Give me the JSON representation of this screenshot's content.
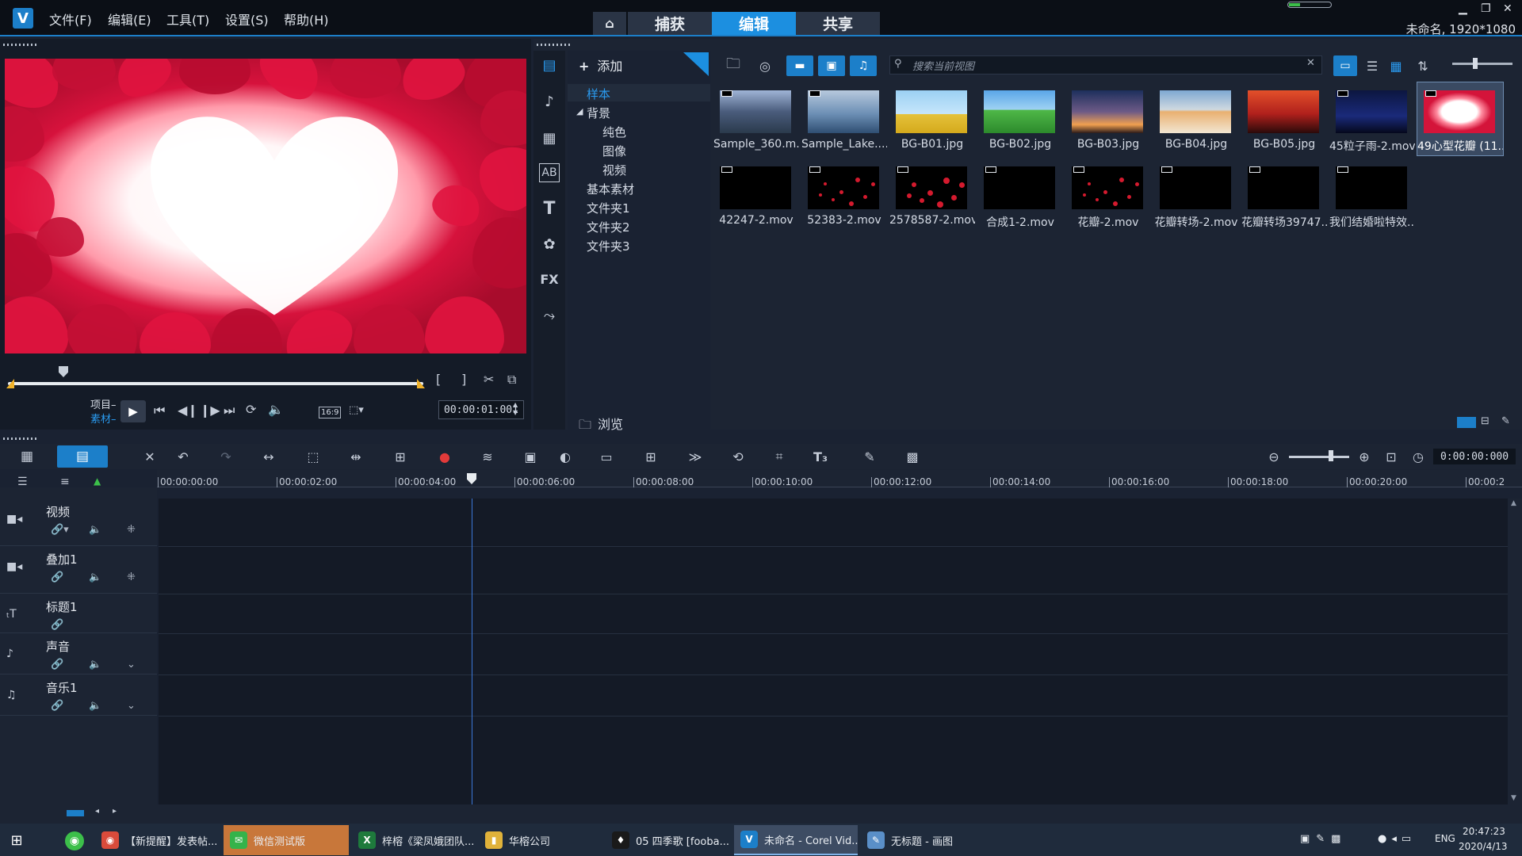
{
  "menu": [
    "文件(F)",
    "编辑(E)",
    "工具(T)",
    "设置(S)",
    "帮助(H)"
  ],
  "workspace_tabs": [
    "捕获",
    "编辑",
    "共享"
  ],
  "active_tab": "编辑",
  "project_title": "未命名, 1920*1080",
  "player": {
    "mode_project": "项目",
    "mode_clip": "素材",
    "aspect": "16:9",
    "timecode": "00:00:01:001"
  },
  "library": {
    "add_label": "添加",
    "browse_label": "浏览",
    "search_placeholder": "搜索当前视图",
    "tree": [
      {
        "label": "样本",
        "level": 0,
        "selected": true
      },
      {
        "label": "背景",
        "level": 0,
        "expanded": true
      },
      {
        "label": "纯色",
        "level": 1
      },
      {
        "label": "图像",
        "level": 1
      },
      {
        "label": "视频",
        "level": 1
      },
      {
        "label": "基本素材",
        "level": 0
      },
      {
        "label": "文件夹1",
        "level": 0
      },
      {
        "label": "文件夹2",
        "level": 0
      },
      {
        "label": "文件夹3",
        "level": 0
      }
    ],
    "thumbnails": [
      {
        "name": "Sample_360.m...",
        "kind": "video"
      },
      {
        "name": "Sample_Lake....",
        "kind": "video"
      },
      {
        "name": "BG-B01.jpg",
        "kind": "image"
      },
      {
        "name": "BG-B02.jpg",
        "kind": "image"
      },
      {
        "name": "BG-B03.jpg",
        "kind": "image"
      },
      {
        "name": "BG-B04.jpg",
        "kind": "image"
      },
      {
        "name": "BG-B05.jpg",
        "kind": "image"
      },
      {
        "name": "45粒子雨-2.mov",
        "kind": "video"
      },
      {
        "name": "49心型花瓣 (11...",
        "kind": "video",
        "selected": true
      },
      {
        "name": "42247-2.mov",
        "kind": "video"
      },
      {
        "name": "52383-2.mov",
        "kind": "video"
      },
      {
        "name": "2578587-2.mov",
        "kind": "video"
      },
      {
        "name": "合成1-2.mov",
        "kind": "video"
      },
      {
        "name": "花瓣-2.mov",
        "kind": "video"
      },
      {
        "name": "花瓣转场-2.mov",
        "kind": "video"
      },
      {
        "name": "花瓣转场39747...",
        "kind": "video"
      },
      {
        "name": "我们结婚啦特效...",
        "kind": "video"
      }
    ]
  },
  "timeline": {
    "time_display": "0:00:00:000",
    "ruler": [
      "00:00:00:00",
      "00:00:02:00",
      "00:00:04:00",
      "00:00:06:00",
      "00:00:08:00",
      "00:00:10:00",
      "00:00:12:00",
      "00:00:14:00",
      "00:00:16:00",
      "00:00:18:00",
      "00:00:20:00",
      "00:00:2"
    ],
    "tracks": [
      "视频",
      "叠加1",
      "标题1",
      "声音",
      "音乐1"
    ]
  },
  "taskbar": {
    "items": [
      "【新提醒】发表帖...",
      "微信测试版",
      "梓榕《梁凤娥团队...",
      "华榕公司",
      "05 四季歌 [fooba...",
      "未命名 - Corel Vid...",
      "无标题 - 画图"
    ],
    "lang": "ENG",
    "time": "20:47:23",
    "date": "2020/4/13"
  },
  "colors": {
    "accent": "#1c8fe0",
    "background": "#1a2232",
    "marker": "#f0b22a"
  }
}
